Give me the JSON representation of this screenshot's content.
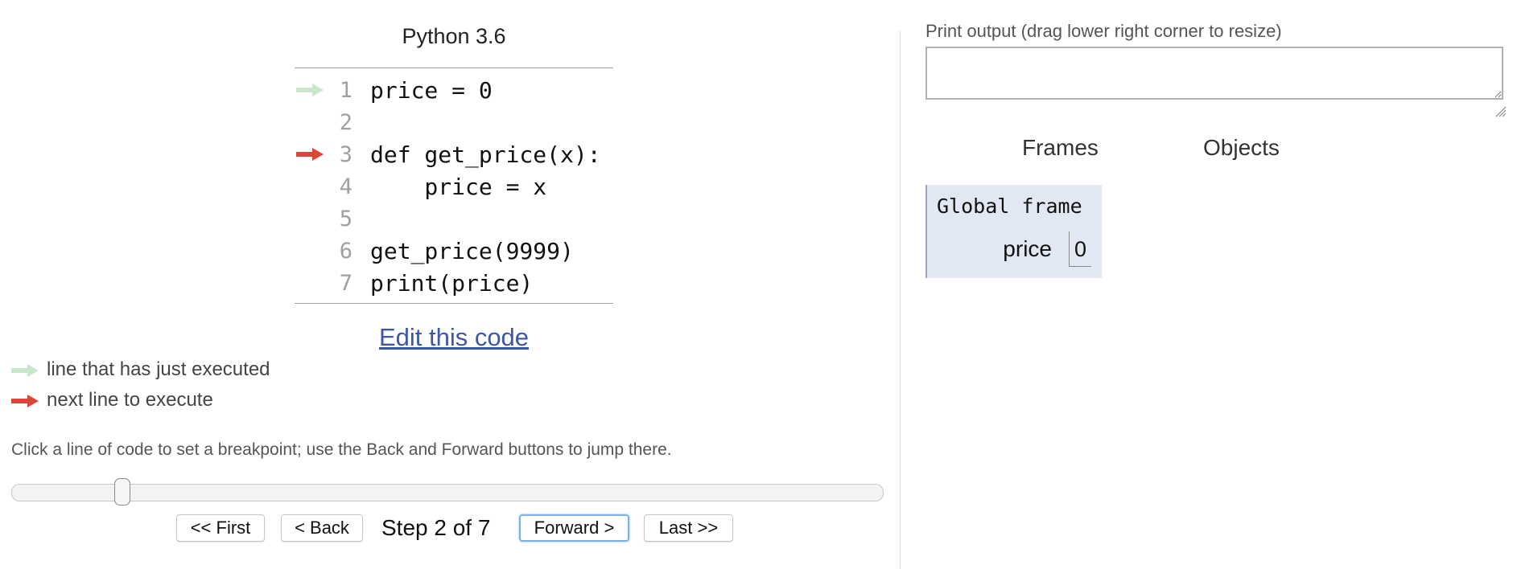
{
  "visualizer": {
    "language": "Python 3.6",
    "code_lines": [
      {
        "number": "1",
        "code": "price = 0",
        "marker": "executed"
      },
      {
        "number": "2",
        "code": "",
        "marker": "none"
      },
      {
        "number": "3",
        "code": "def get_price(x):",
        "marker": "next"
      },
      {
        "number": "4",
        "code": "    price = x",
        "marker": "none"
      },
      {
        "number": "5",
        "code": "",
        "marker": "none"
      },
      {
        "number": "6",
        "code": "get_price(9999)",
        "marker": "none"
      },
      {
        "number": "7",
        "code": "print(price)",
        "marker": "none"
      }
    ],
    "edit_link": "Edit this code",
    "legend": {
      "executed": "line that has just executed",
      "next": "next line to execute"
    },
    "hint": "Click a line of code to set a breakpoint; use the Back and Forward buttons to jump there.",
    "slider": {
      "step": 2,
      "total": 7,
      "fraction": 0.12
    },
    "nav": {
      "first": "<< First",
      "back": "< Back",
      "step_label": "Step 2 of 7",
      "forward": "Forward >",
      "last": "Last >>"
    }
  },
  "output": {
    "label": "Print output (drag lower right corner to resize)",
    "content": ""
  },
  "memory": {
    "frames_heading": "Frames",
    "objects_heading": "Objects",
    "global_frame": {
      "title": "Global frame",
      "variables": [
        {
          "name": "price",
          "value": "0"
        }
      ]
    }
  },
  "colors": {
    "executed_arrow": "#c8e6c9",
    "next_arrow": "#d9463a",
    "link": "#3b57a6",
    "frame_bg": "#e2e8f3"
  },
  "icons": {
    "executed": "light-green-right-arrow",
    "next": "red-right-arrow",
    "resize": "resize-grip"
  }
}
